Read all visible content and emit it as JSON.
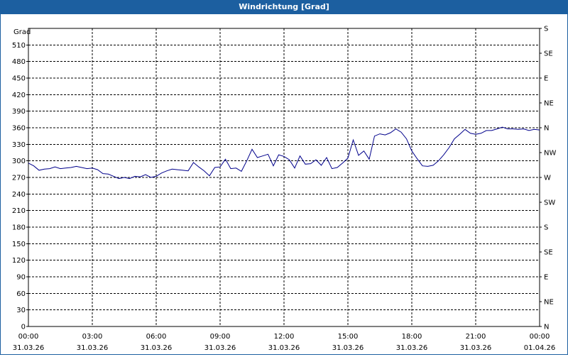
{
  "title": "Windrichtung [Grad]",
  "chart_data": {
    "type": "line",
    "title": "Windrichtung [Grad]",
    "ylabel": "Grad",
    "ylim": [
      0,
      540
    ],
    "yticks": [
      0,
      30,
      60,
      90,
      120,
      150,
      180,
      210,
      240,
      270,
      300,
      330,
      360,
      390,
      420,
      450,
      480,
      510
    ],
    "right_ticks": [
      "N",
      "NE",
      "E",
      "SE",
      "S",
      "SW",
      "W",
      "NW",
      "N",
      "NE",
      "E",
      "SE",
      "S"
    ],
    "right_tick_values": [
      0,
      45,
      90,
      135,
      180,
      225,
      270,
      315,
      360,
      405,
      450,
      495,
      540
    ],
    "xlim_hours": [
      0,
      24
    ],
    "xticks": [
      {
        "time": "00:00",
        "date": "31.03.26"
      },
      {
        "time": "03:00",
        "date": "31.03.26"
      },
      {
        "time": "06:00",
        "date": "31.03.26"
      },
      {
        "time": "09:00",
        "date": "31.03.26"
      },
      {
        "time": "12:00",
        "date": "31.03.26"
      },
      {
        "time": "15:00",
        "date": "31.03.26"
      },
      {
        "time": "18:00",
        "date": "31.03.26"
      },
      {
        "time": "21:00",
        "date": "31.03.26"
      },
      {
        "time": "00:00",
        "date": "01.04.26"
      }
    ],
    "grid": true,
    "line_color": "#00008b",
    "series": [
      {
        "x": [
          0,
          0.25,
          0.5,
          0.75,
          1,
          1.25,
          1.5,
          1.75,
          2,
          2.25,
          2.5,
          2.75,
          3,
          3.25,
          3.5,
          3.75,
          4,
          4.25,
          4.5,
          4.75,
          5,
          5.25,
          5.5,
          5.75,
          6,
          6.25,
          6.5,
          6.75,
          7,
          7.25,
          7.5,
          7.75,
          8,
          8.25,
          8.5,
          8.75,
          9,
          9.25,
          9.5,
          9.75,
          10,
          10.25,
          10.5,
          10.75,
          11,
          11.25,
          11.5,
          11.75,
          12,
          12.25,
          12.5,
          12.75,
          13,
          13.25,
          13.5,
          13.75,
          14,
          14.25,
          14.5,
          14.75,
          15,
          15.25,
          15.5,
          15.75,
          16,
          16.25,
          16.5,
          16.75,
          17,
          17.25,
          17.5,
          17.75,
          18,
          18.25,
          18.5,
          18.75,
          19,
          19.25,
          19.5,
          19.75,
          20,
          20.25,
          20.5,
          20.75,
          21,
          21.25,
          21.5,
          21.75,
          22,
          22.25,
          22.5,
          22.75,
          23,
          23.25,
          23.5,
          23.75,
          24
        ],
        "values": [
          296,
          291,
          283,
          285,
          286,
          289,
          286,
          287,
          288,
          290,
          288,
          286,
          287,
          284,
          277,
          276,
          272,
          268,
          270,
          268,
          272,
          271,
          275,
          270,
          272,
          278,
          282,
          285,
          284,
          283,
          282,
          297,
          289,
          282,
          273,
          288,
          289,
          303,
          286,
          287,
          281,
          300,
          321,
          306,
          309,
          312,
          291,
          311,
          308,
          302,
          287,
          309,
          294,
          295,
          302,
          292,
          306,
          286,
          288,
          296,
          305,
          338,
          310,
          318,
          303,
          345,
          349,
          347,
          351,
          358,
          352,
          340,
          318,
          304,
          291,
          290,
          292,
          300,
          311,
          324,
          340,
          348,
          357,
          350,
          348,
          350,
          355,
          355,
          358,
          361,
          358,
          358,
          357,
          358,
          355,
          357,
          356
        ]
      }
    ]
  }
}
